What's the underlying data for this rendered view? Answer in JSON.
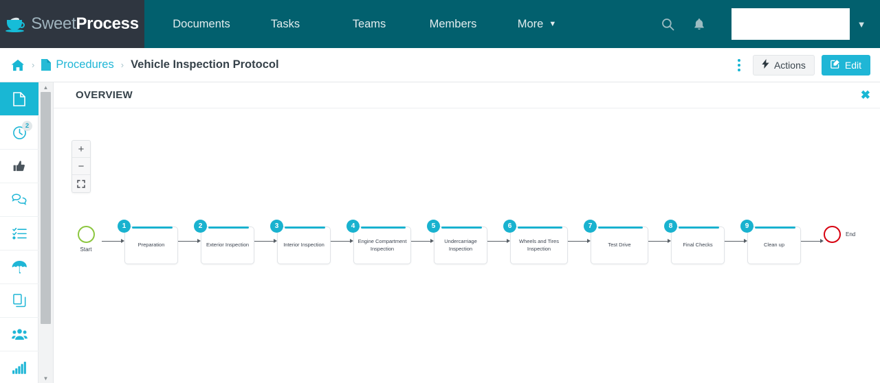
{
  "brand": {
    "name_light": "Sweet",
    "name_bold": "Process",
    "logo_icon": "coffee-cup-icon",
    "accent": "#19b7d4",
    "nav_bg": "#02606e",
    "logo_bg": "#2f3640"
  },
  "topnav": {
    "items": [
      {
        "label": "Documents",
        "icon": ""
      },
      {
        "label": "Tasks",
        "icon": ""
      },
      {
        "label": "Teams",
        "icon": ""
      },
      {
        "label": "Members",
        "icon": ""
      },
      {
        "label": "More",
        "icon": "chevron-down-icon"
      }
    ],
    "search_icon": "search-icon",
    "bell_icon": "bell-icon",
    "avatar_icon": "avatar-placeholder",
    "account_caret": "chevron-down-icon"
  },
  "breadcrumb": {
    "home_icon": "home-icon",
    "separator": "›",
    "doc_icon": "document-icon",
    "parent": "Procedures",
    "current": "Vehicle Inspection Protocol"
  },
  "crumb_actions": {
    "kebab_icon": "vertical-dots-icon",
    "actions_label": "Actions",
    "actions_icon": "lightning-bolt-icon",
    "edit_label": "Edit",
    "edit_icon": "pencil-square-icon"
  },
  "rail": {
    "items": [
      {
        "name": "document",
        "icon": "document-icon",
        "active": true,
        "badge": ""
      },
      {
        "name": "history",
        "icon": "clock-icon",
        "active": false,
        "badge": "2"
      },
      {
        "name": "approvals",
        "icon": "thumbs-up-icon",
        "active": false,
        "badge": ""
      },
      {
        "name": "comments",
        "icon": "chat-bubbles-icon",
        "active": false,
        "badge": ""
      },
      {
        "name": "checklist",
        "icon": "checklist-icon",
        "active": false,
        "badge": ""
      },
      {
        "name": "policies",
        "icon": "umbrella-icon",
        "active": false,
        "badge": ""
      },
      {
        "name": "duplicate",
        "icon": "copy-icon",
        "active": false,
        "badge": ""
      },
      {
        "name": "teams",
        "icon": "users-icon",
        "active": false,
        "badge": ""
      },
      {
        "name": "reports",
        "icon": "bar-chart-icon",
        "active": false,
        "badge": ""
      }
    ]
  },
  "scrollbar": {
    "up_icon": "caret-up-icon",
    "down_icon": "caret-down-icon"
  },
  "panel": {
    "title": "OVERVIEW",
    "close_icon": "close-icon",
    "close_glyph": "✖"
  },
  "zoom_controls": {
    "zoom_in": "+",
    "zoom_out": "−",
    "fit": "⛶",
    "zoom_in_name": "zoom-in-button",
    "zoom_out_name": "zoom-out-button",
    "fit_name": "fit-to-screen-button"
  },
  "flowchart": {
    "start": {
      "label": "Start",
      "color": "#8cc63f"
    },
    "end": {
      "label": "End",
      "color": "#d7000f"
    },
    "steps": [
      {
        "num": "1",
        "label": "Preparation"
      },
      {
        "num": "2",
        "label": "Exterior Inspection"
      },
      {
        "num": "3",
        "label": "Interior Inspection"
      },
      {
        "num": "4",
        "label": "Engine Compartment Inspection"
      },
      {
        "num": "5",
        "label": "Undercarriage Inspection"
      },
      {
        "num": "6",
        "label": "Wheels and Tires Inspection"
      },
      {
        "num": "7",
        "label": "Test Drive"
      },
      {
        "num": "8",
        "label": "Final Checks"
      },
      {
        "num": "9",
        "label": "Clean up"
      }
    ]
  }
}
